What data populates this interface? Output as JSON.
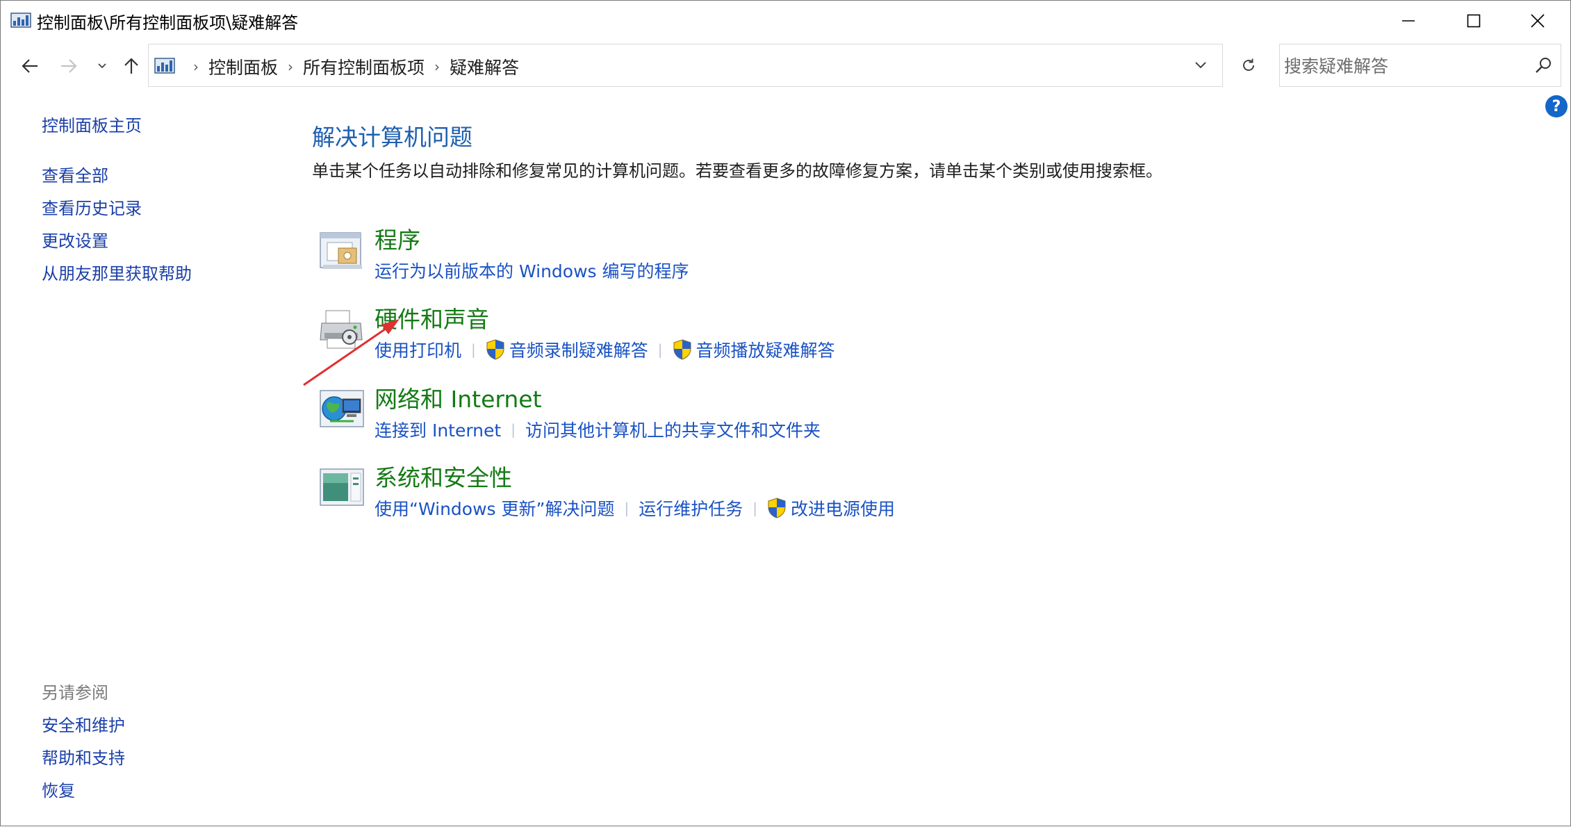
{
  "window": {
    "title": "控制面板\\所有控制面板项\\疑难解答",
    "icons": {
      "app": "control-panel-icon",
      "minimize": "minimize-icon",
      "maximize": "maximize-icon",
      "close": "close-icon"
    }
  },
  "navigation": {
    "back_icon": "back-arrow-icon",
    "forward_icon": "forward-arrow-icon",
    "recent_icon": "chevron-down-icon",
    "up_icon": "up-arrow-icon"
  },
  "address": {
    "crumbs": [
      "控制面板",
      "所有控制面板项",
      "疑难解答"
    ]
  },
  "search": {
    "placeholder": "搜索疑难解答"
  },
  "help": {
    "label": "?"
  },
  "sidebar": {
    "home": "控制面板主页",
    "links": [
      "查看全部",
      "查看历史记录",
      "更改设置",
      "从朋友那里获取帮助"
    ],
    "see_also_heading": "另请参阅",
    "see_also": [
      "安全和维护",
      "帮助和支持",
      "恢复"
    ]
  },
  "main": {
    "title": "解决计算机问题",
    "description": "单击某个任务以自动排除和修复常见的计算机问题。若要查看更多的故障修复方案，请单击某个类别或使用搜索框。",
    "categories": [
      {
        "title": "程序",
        "icon": "programs-icon",
        "links": [
          {
            "label": "运行为以前版本的 Windows 编写的程序",
            "shield": false
          }
        ]
      },
      {
        "title": "硬件和声音",
        "icon": "printer-hardware-icon",
        "links": [
          {
            "label": "使用打印机",
            "shield": false
          },
          {
            "label": "音频录制疑难解答",
            "shield": true
          },
          {
            "label": "音频播放疑难解答",
            "shield": true
          }
        ]
      },
      {
        "title": "网络和 Internet",
        "icon": "network-globe-icon",
        "links": [
          {
            "label": "连接到 Internet",
            "shield": false
          },
          {
            "label": "访问其他计算机上的共享文件和文件夹",
            "shield": false
          }
        ]
      },
      {
        "title": "系统和安全性",
        "icon": "system-security-icon",
        "links": [
          {
            "label": "使用“Windows 更新”解决问题",
            "shield": false
          },
          {
            "label": "运行维护任务",
            "shield": false
          },
          {
            "label": "改进电源使用",
            "shield": true
          }
        ]
      }
    ]
  },
  "annotation": {
    "color": "#e03030"
  },
  "colors": {
    "link": "#1a52c4",
    "category": "#147a14",
    "title": "#1d5fb0",
    "sidebar_link": "#1a3fa8"
  }
}
